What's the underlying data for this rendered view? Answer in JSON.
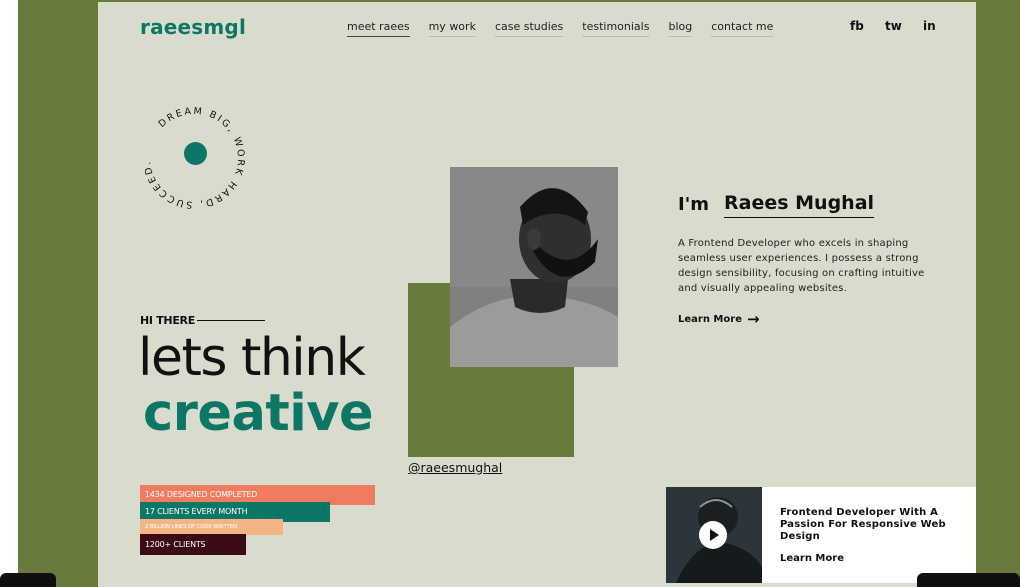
{
  "brand": {
    "logo": "raeesmgl"
  },
  "nav": {
    "items": [
      {
        "label": "meet raees",
        "active": true
      },
      {
        "label": "my work",
        "active": false
      },
      {
        "label": "case studies",
        "active": false
      },
      {
        "label": "testimonials",
        "active": false
      },
      {
        "label": "blog",
        "active": false
      },
      {
        "label": "contact me",
        "active": false
      }
    ]
  },
  "social": {
    "facebook": "fb",
    "twitter": "tw",
    "linkedin": "in"
  },
  "badge": {
    "circular_text": "DREAM BIG, WORK HARD, SUCCEED."
  },
  "hero": {
    "greeting": "HI THERE",
    "line1": "lets think",
    "line2": "creative"
  },
  "stats": [
    {
      "label": "1434 DESIGNED COMPLETED",
      "color": "#f07c5f"
    },
    {
      "label": "17 CLIENTS EVERY MONTH",
      "color": "#0d7766"
    },
    {
      "label": "2 BILLION LINES OF CODE WRITTEN",
      "color": "#f5b486"
    },
    {
      "label": "1200+ CLIENTS",
      "color": "#3a0b16"
    }
  ],
  "profile": {
    "handle": "@raeesmughal",
    "intro": "I'm",
    "name": "Raees Mughal",
    "bio": "A Frontend Developer who excels in shaping seamless user experiences. I possess a strong design sensibility, focusing on crafting intuitive and visually appealing websites.",
    "learn_more": "Learn More"
  },
  "video_card": {
    "title": "Frontend Developer With A Passion For Responsive Web Design",
    "learn_more": "Learn More"
  },
  "colors": {
    "accent_teal": "#0d7766",
    "olive": "#687a3e",
    "page_bg": "#d9dccd"
  }
}
